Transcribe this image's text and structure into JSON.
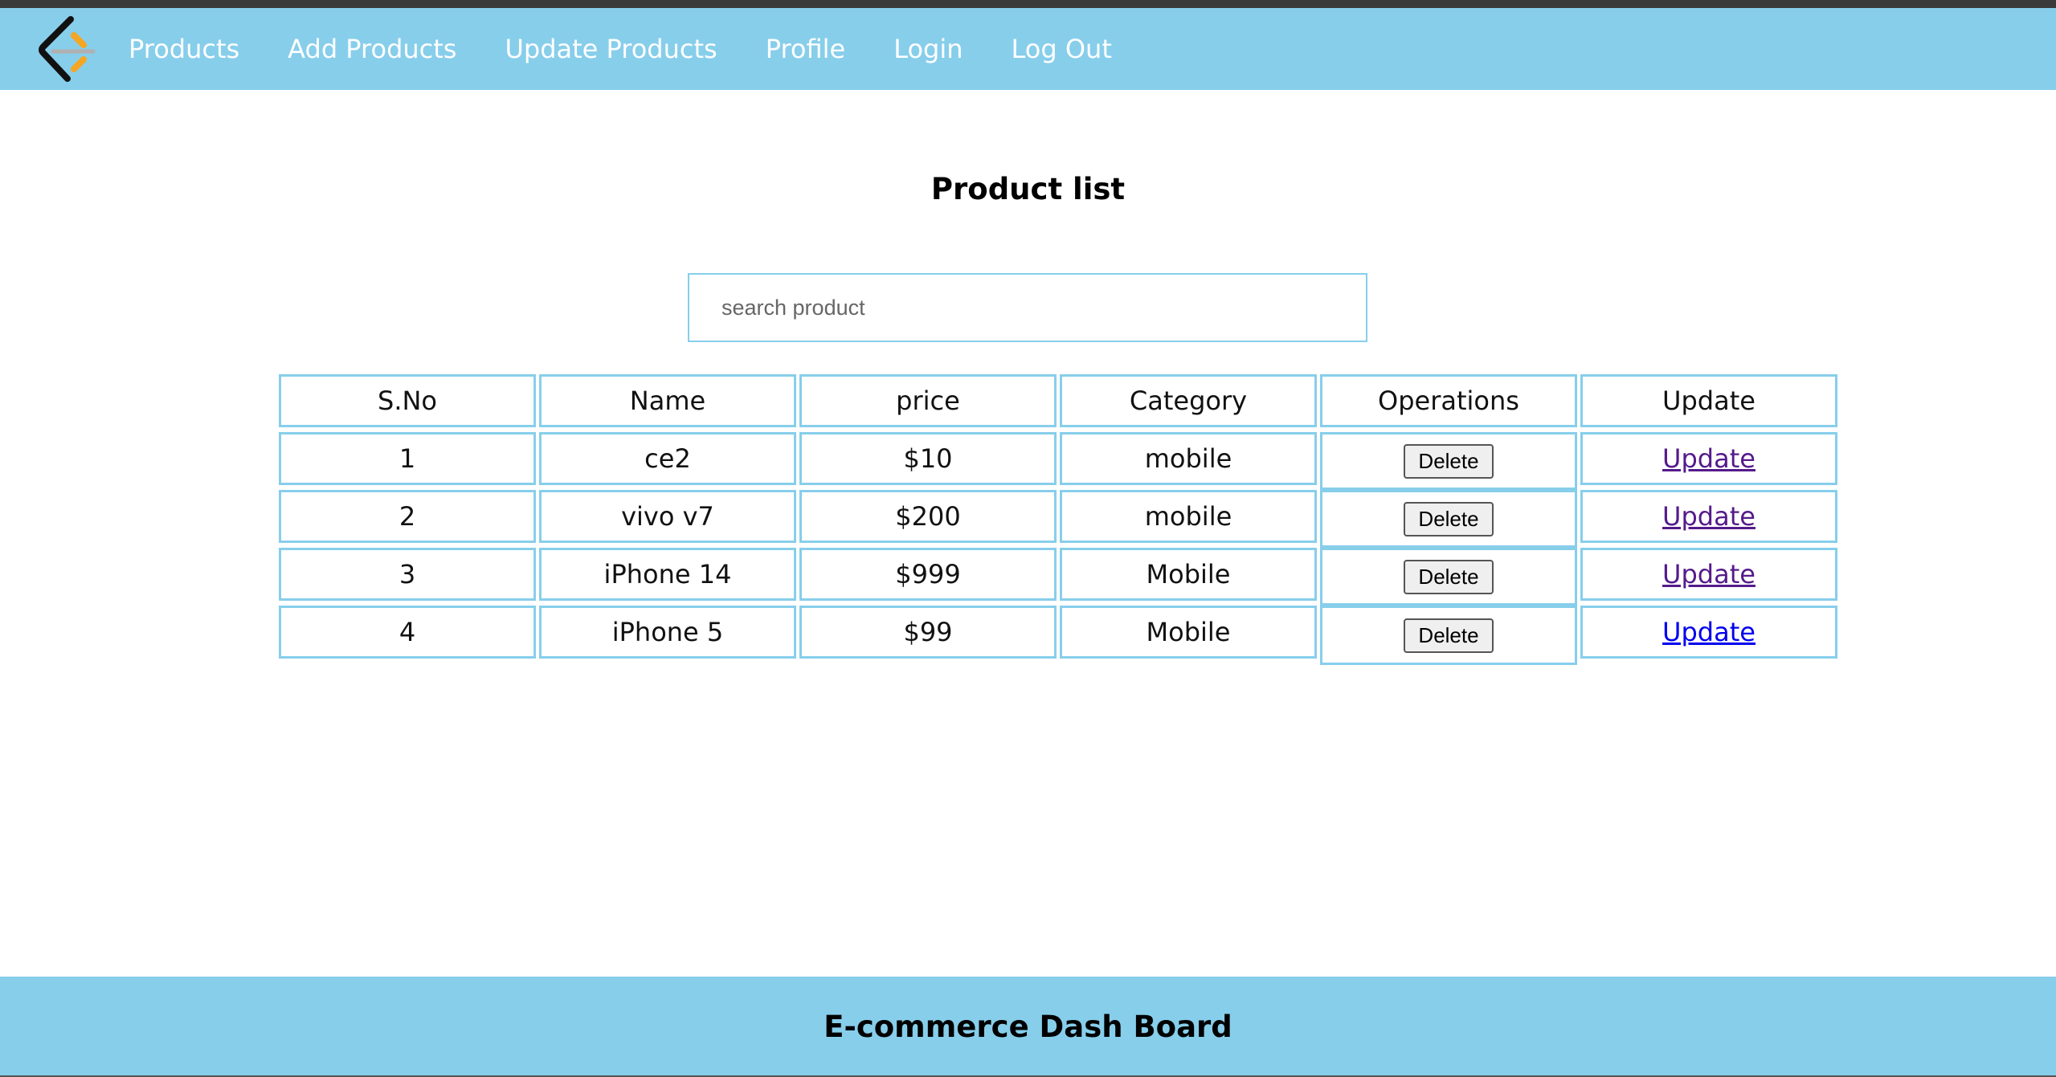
{
  "nav": {
    "links": [
      {
        "label": "Products"
      },
      {
        "label": "Add Products"
      },
      {
        "label": "Update Products"
      },
      {
        "label": "Profile"
      },
      {
        "label": "Login"
      },
      {
        "label": "Log Out"
      }
    ],
    "background": "#87ceeb",
    "logo_icon": "code-bracket-logo-icon"
  },
  "main": {
    "title": "Product list",
    "search": {
      "placeholder": "search product",
      "value": ""
    }
  },
  "table": {
    "headers": [
      "S.No",
      "Name",
      "price",
      "Category",
      "Operations",
      "Update"
    ],
    "rows": [
      {
        "sno": "1",
        "name": "ce2",
        "price": "$10",
        "category": "mobile",
        "operation": "Delete",
        "update": "Update"
      },
      {
        "sno": "2",
        "name": "vivo v7",
        "price": "$200",
        "category": "mobile",
        "operation": "Delete",
        "update": "Update"
      },
      {
        "sno": "3",
        "name": "iPhone 14",
        "price": "$999",
        "category": "Mobile",
        "operation": "Delete",
        "update": "Update"
      },
      {
        "sno": "4",
        "name": "iPhone 5",
        "price": "$99",
        "category": "Mobile",
        "operation": "Delete",
        "update": "Update"
      }
    ],
    "border_color": "#87ceeb"
  },
  "footer": {
    "text": "E-commerce Dash Board"
  }
}
